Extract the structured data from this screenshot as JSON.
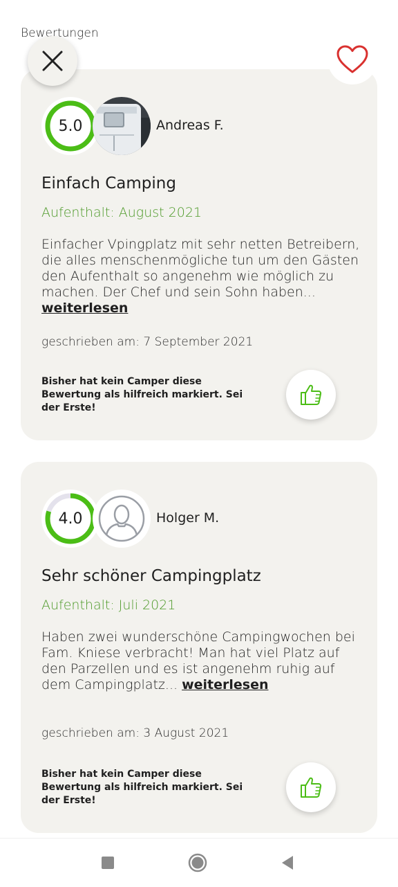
{
  "header": {
    "title": "Bewertungen",
    "close_icon": "close-icon",
    "favorite_icon": "heart-outline-icon",
    "favorite_color": "#d9312f"
  },
  "colors": {
    "accent_green": "#4e9a2a",
    "ring_green": "#4bbd16",
    "card_bg": "#f3f2ee"
  },
  "reviews": [
    {
      "rating": "5.0",
      "rating_value": 5.0,
      "rating_max": 5,
      "avatar": "caravan-photo",
      "reviewer": "Andreas F.",
      "title": "Einfach Camping",
      "stay": "Aufenthalt: August 2021",
      "text": "Einfacher Vpingplatz mit sehr netten Betreibern, die alles menschenmögliche tun um den Gästen den Aufenthalt so angenehm wie möglich zu machen. Der Chef und sein Sohn haben...",
      "read_more": "weiterlesen",
      "written": "geschrieben am: 7 September 2021",
      "helpful": "Bisher hat kein Camper diese Bewertung als hilfreich markiert. Sei der Erste!",
      "like_icon": "thumbs-up-icon"
    },
    {
      "rating": "4.0",
      "rating_value": 4.0,
      "rating_max": 5,
      "avatar": "default-user-avatar",
      "reviewer": "Holger M.",
      "title": "Sehr schöner Campingplatz",
      "stay": "Aufenthalt: Juli 2021",
      "text": "Haben zwei wunderschöne Campingwochen bei Fam. Kniese verbracht! Man hat viel Platz auf den Parzellen und es ist angenehm ruhig auf dem Campingplatz...",
      "read_more": "weiterlesen",
      "written": "geschrieben am: 3 August 2021",
      "helpful": "Bisher hat kein Camper diese Bewertung als hilfreich markiert. Sei der Erste!",
      "like_icon": "thumbs-up-icon"
    }
  ],
  "system_nav": {
    "recent_icon": "square-recents-icon",
    "home_icon": "circle-home-icon",
    "back_icon": "triangle-back-icon"
  }
}
